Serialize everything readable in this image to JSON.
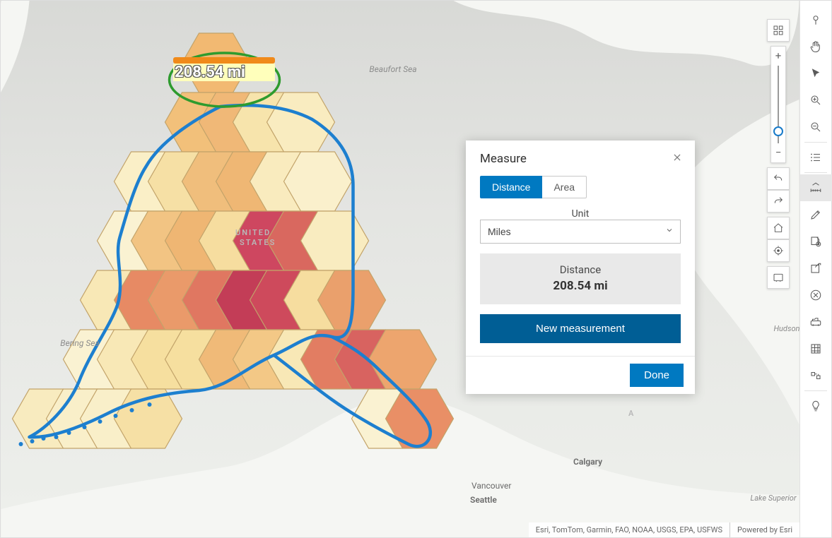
{
  "measure_on_map": "208.54 mi",
  "map_labels": {
    "beaufort": "Beaufort Sea",
    "bering": "Bering Sea",
    "hudson": "Hudson Bay",
    "superior": "Lake Superior",
    "country_us_1": "UNITED",
    "country_us_2": "STATES",
    "country_ca": "A",
    "city_calgary": "Calgary",
    "city_vancouver": "Vancouver",
    "city_seattle": "Seattle"
  },
  "attribution": {
    "sources": "Esri, TomTom, Garmin, FAO, NOAA, USGS, EPA, USFWS",
    "powered": "Powered by Esri"
  },
  "panel": {
    "title": "Measure",
    "tab_distance": "Distance",
    "tab_area": "Area",
    "unit_label": "Unit",
    "unit_selected": "Miles",
    "result_label": "Distance",
    "result_value": "208.54 mi",
    "new_btn": "New measurement",
    "done": "Done"
  },
  "tools": [
    {
      "name": "pin-icon"
    },
    {
      "name": "hand-pan-icon"
    },
    {
      "name": "cursor-arrow-icon"
    },
    {
      "name": "zoom-in-icon"
    },
    {
      "name": "zoom-out-icon"
    },
    {
      "divider": true
    },
    {
      "name": "list-icon"
    },
    {
      "divider": true
    },
    {
      "name": "measure-icon",
      "selected": true
    },
    {
      "name": "edit-icon"
    },
    {
      "name": "add-data-icon"
    },
    {
      "name": "share-icon"
    },
    {
      "name": "clear-icon"
    },
    {
      "name": "directions-icon"
    },
    {
      "name": "basemap-grid-icon"
    },
    {
      "name": "select-lasso-icon"
    },
    {
      "divider": true
    },
    {
      "name": "hint-bulb-icon"
    }
  ],
  "float_tools": [
    {
      "name": "basemap-gallery-icon"
    },
    {
      "name": "undo-icon"
    },
    {
      "name": "redo-icon"
    },
    {
      "name": "home-extent-icon"
    },
    {
      "name": "locate-icon"
    },
    {
      "name": "fullscreen-icon"
    }
  ]
}
